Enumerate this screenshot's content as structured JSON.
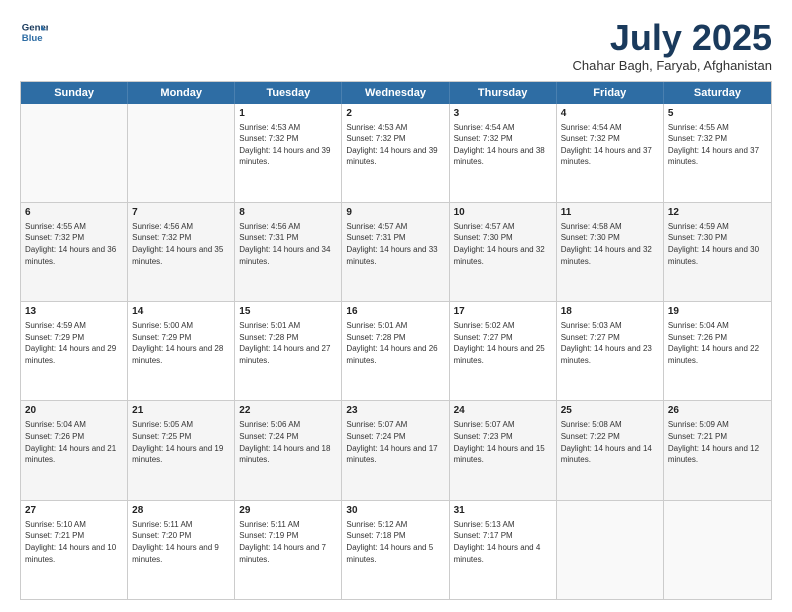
{
  "header": {
    "logo_line1": "General",
    "logo_line2": "Blue",
    "month": "July 2025",
    "location": "Chahar Bagh, Faryab, Afghanistan"
  },
  "days": [
    "Sunday",
    "Monday",
    "Tuesday",
    "Wednesday",
    "Thursday",
    "Friday",
    "Saturday"
  ],
  "rows": [
    [
      {
        "day": "",
        "sunrise": "",
        "sunset": "",
        "daylight": ""
      },
      {
        "day": "",
        "sunrise": "",
        "sunset": "",
        "daylight": ""
      },
      {
        "day": "1",
        "sunrise": "Sunrise: 4:53 AM",
        "sunset": "Sunset: 7:32 PM",
        "daylight": "Daylight: 14 hours and 39 minutes."
      },
      {
        "day": "2",
        "sunrise": "Sunrise: 4:53 AM",
        "sunset": "Sunset: 7:32 PM",
        "daylight": "Daylight: 14 hours and 39 minutes."
      },
      {
        "day": "3",
        "sunrise": "Sunrise: 4:54 AM",
        "sunset": "Sunset: 7:32 PM",
        "daylight": "Daylight: 14 hours and 38 minutes."
      },
      {
        "day": "4",
        "sunrise": "Sunrise: 4:54 AM",
        "sunset": "Sunset: 7:32 PM",
        "daylight": "Daylight: 14 hours and 37 minutes."
      },
      {
        "day": "5",
        "sunrise": "Sunrise: 4:55 AM",
        "sunset": "Sunset: 7:32 PM",
        "daylight": "Daylight: 14 hours and 37 minutes."
      }
    ],
    [
      {
        "day": "6",
        "sunrise": "Sunrise: 4:55 AM",
        "sunset": "Sunset: 7:32 PM",
        "daylight": "Daylight: 14 hours and 36 minutes."
      },
      {
        "day": "7",
        "sunrise": "Sunrise: 4:56 AM",
        "sunset": "Sunset: 7:32 PM",
        "daylight": "Daylight: 14 hours and 35 minutes."
      },
      {
        "day": "8",
        "sunrise": "Sunrise: 4:56 AM",
        "sunset": "Sunset: 7:31 PM",
        "daylight": "Daylight: 14 hours and 34 minutes."
      },
      {
        "day": "9",
        "sunrise": "Sunrise: 4:57 AM",
        "sunset": "Sunset: 7:31 PM",
        "daylight": "Daylight: 14 hours and 33 minutes."
      },
      {
        "day": "10",
        "sunrise": "Sunrise: 4:57 AM",
        "sunset": "Sunset: 7:30 PM",
        "daylight": "Daylight: 14 hours and 32 minutes."
      },
      {
        "day": "11",
        "sunrise": "Sunrise: 4:58 AM",
        "sunset": "Sunset: 7:30 PM",
        "daylight": "Daylight: 14 hours and 32 minutes."
      },
      {
        "day": "12",
        "sunrise": "Sunrise: 4:59 AM",
        "sunset": "Sunset: 7:30 PM",
        "daylight": "Daylight: 14 hours and 30 minutes."
      }
    ],
    [
      {
        "day": "13",
        "sunrise": "Sunrise: 4:59 AM",
        "sunset": "Sunset: 7:29 PM",
        "daylight": "Daylight: 14 hours and 29 minutes."
      },
      {
        "day": "14",
        "sunrise": "Sunrise: 5:00 AM",
        "sunset": "Sunset: 7:29 PM",
        "daylight": "Daylight: 14 hours and 28 minutes."
      },
      {
        "day": "15",
        "sunrise": "Sunrise: 5:01 AM",
        "sunset": "Sunset: 7:28 PM",
        "daylight": "Daylight: 14 hours and 27 minutes."
      },
      {
        "day": "16",
        "sunrise": "Sunrise: 5:01 AM",
        "sunset": "Sunset: 7:28 PM",
        "daylight": "Daylight: 14 hours and 26 minutes."
      },
      {
        "day": "17",
        "sunrise": "Sunrise: 5:02 AM",
        "sunset": "Sunset: 7:27 PM",
        "daylight": "Daylight: 14 hours and 25 minutes."
      },
      {
        "day": "18",
        "sunrise": "Sunrise: 5:03 AM",
        "sunset": "Sunset: 7:27 PM",
        "daylight": "Daylight: 14 hours and 23 minutes."
      },
      {
        "day": "19",
        "sunrise": "Sunrise: 5:04 AM",
        "sunset": "Sunset: 7:26 PM",
        "daylight": "Daylight: 14 hours and 22 minutes."
      }
    ],
    [
      {
        "day": "20",
        "sunrise": "Sunrise: 5:04 AM",
        "sunset": "Sunset: 7:26 PM",
        "daylight": "Daylight: 14 hours and 21 minutes."
      },
      {
        "day": "21",
        "sunrise": "Sunrise: 5:05 AM",
        "sunset": "Sunset: 7:25 PM",
        "daylight": "Daylight: 14 hours and 19 minutes."
      },
      {
        "day": "22",
        "sunrise": "Sunrise: 5:06 AM",
        "sunset": "Sunset: 7:24 PM",
        "daylight": "Daylight: 14 hours and 18 minutes."
      },
      {
        "day": "23",
        "sunrise": "Sunrise: 5:07 AM",
        "sunset": "Sunset: 7:24 PM",
        "daylight": "Daylight: 14 hours and 17 minutes."
      },
      {
        "day": "24",
        "sunrise": "Sunrise: 5:07 AM",
        "sunset": "Sunset: 7:23 PM",
        "daylight": "Daylight: 14 hours and 15 minutes."
      },
      {
        "day": "25",
        "sunrise": "Sunrise: 5:08 AM",
        "sunset": "Sunset: 7:22 PM",
        "daylight": "Daylight: 14 hours and 14 minutes."
      },
      {
        "day": "26",
        "sunrise": "Sunrise: 5:09 AM",
        "sunset": "Sunset: 7:21 PM",
        "daylight": "Daylight: 14 hours and 12 minutes."
      }
    ],
    [
      {
        "day": "27",
        "sunrise": "Sunrise: 5:10 AM",
        "sunset": "Sunset: 7:21 PM",
        "daylight": "Daylight: 14 hours and 10 minutes."
      },
      {
        "day": "28",
        "sunrise": "Sunrise: 5:11 AM",
        "sunset": "Sunset: 7:20 PM",
        "daylight": "Daylight: 14 hours and 9 minutes."
      },
      {
        "day": "29",
        "sunrise": "Sunrise: 5:11 AM",
        "sunset": "Sunset: 7:19 PM",
        "daylight": "Daylight: 14 hours and 7 minutes."
      },
      {
        "day": "30",
        "sunrise": "Sunrise: 5:12 AM",
        "sunset": "Sunset: 7:18 PM",
        "daylight": "Daylight: 14 hours and 5 minutes."
      },
      {
        "day": "31",
        "sunrise": "Sunrise: 5:13 AM",
        "sunset": "Sunset: 7:17 PM",
        "daylight": "Daylight: 14 hours and 4 minutes."
      },
      {
        "day": "",
        "sunrise": "",
        "sunset": "",
        "daylight": ""
      },
      {
        "day": "",
        "sunrise": "",
        "sunset": "",
        "daylight": ""
      }
    ]
  ]
}
